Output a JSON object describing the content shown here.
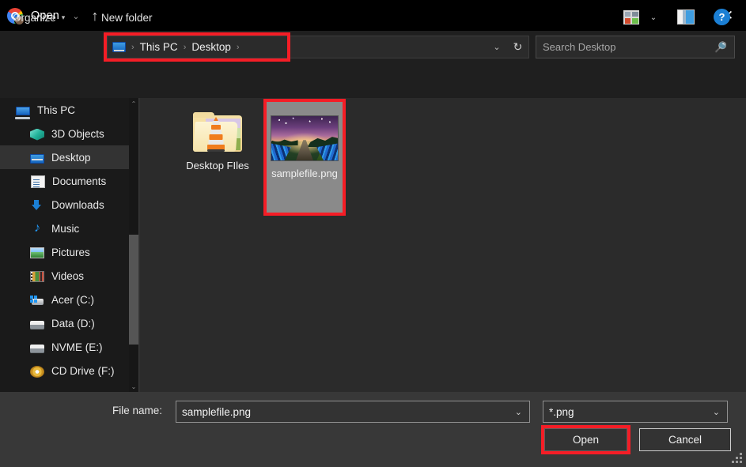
{
  "window": {
    "title": "Open",
    "app_icon": "chrome-icon",
    "close_label": "✕"
  },
  "nav": {
    "back": "←",
    "forward": "→",
    "recent": "⌄",
    "up": "↑"
  },
  "address": {
    "icon": "desktop-icon",
    "crumbs": [
      "This PC",
      "Desktop"
    ],
    "separator": "›",
    "trailing_separator": "›",
    "dropdown": "⌄",
    "refresh": "↻",
    "highlight_color": "#f51d26"
  },
  "search": {
    "placeholder": "Search Desktop",
    "icon": "search-icon"
  },
  "command_bar": {
    "organize": "Organize",
    "organize_caret": "▾",
    "new_folder": "New folder",
    "view_icon": "view-options-icon",
    "view_caret": "⌄",
    "preview_pane_icon": "preview-pane-icon",
    "help_icon": "?"
  },
  "sidebar": {
    "items": [
      {
        "label": "This PC",
        "icon": "this-pc-icon",
        "indent": false,
        "selected": false
      },
      {
        "label": "3D Objects",
        "icon": "3d-objects-icon",
        "indent": true,
        "selected": false
      },
      {
        "label": "Desktop",
        "icon": "desktop-icon",
        "indent": true,
        "selected": true
      },
      {
        "label": "Documents",
        "icon": "documents-icon",
        "indent": true,
        "selected": false
      },
      {
        "label": "Downloads",
        "icon": "downloads-icon",
        "indent": true,
        "selected": false
      },
      {
        "label": "Music",
        "icon": "music-icon",
        "indent": true,
        "selected": false
      },
      {
        "label": "Pictures",
        "icon": "pictures-icon",
        "indent": true,
        "selected": false
      },
      {
        "label": "Videos",
        "icon": "videos-icon",
        "indent": true,
        "selected": false
      },
      {
        "label": "Acer (C:)",
        "icon": "system-drive-icon",
        "indent": true,
        "selected": false
      },
      {
        "label": "Data (D:)",
        "icon": "drive-icon",
        "indent": true,
        "selected": false
      },
      {
        "label": "NVME (E:)",
        "icon": "drive-icon",
        "indent": true,
        "selected": false
      },
      {
        "label": "CD Drive (F:)",
        "icon": "cd-drive-icon",
        "indent": true,
        "selected": false
      }
    ],
    "scroll_up": "⌃",
    "scroll_down": "⌄"
  },
  "files": [
    {
      "name": "Desktop FIles",
      "icon": "folder-vlc-icon",
      "selected": false
    },
    {
      "name": "samplefile.png",
      "icon": "image-thumbnail",
      "selected": true
    }
  ],
  "footer": {
    "file_name_label": "File name:",
    "file_name_value": "samplefile.png",
    "file_name_caret": "⌄",
    "file_type_value": "*.png",
    "file_type_caret": "⌄",
    "open_label": "Open",
    "cancel_label": "Cancel",
    "resize_grip": "resize-grip"
  },
  "colors": {
    "highlight_red": "#f51d26",
    "selection_gray": "#8a8a8a",
    "accent_blue": "#1b7fd4"
  }
}
